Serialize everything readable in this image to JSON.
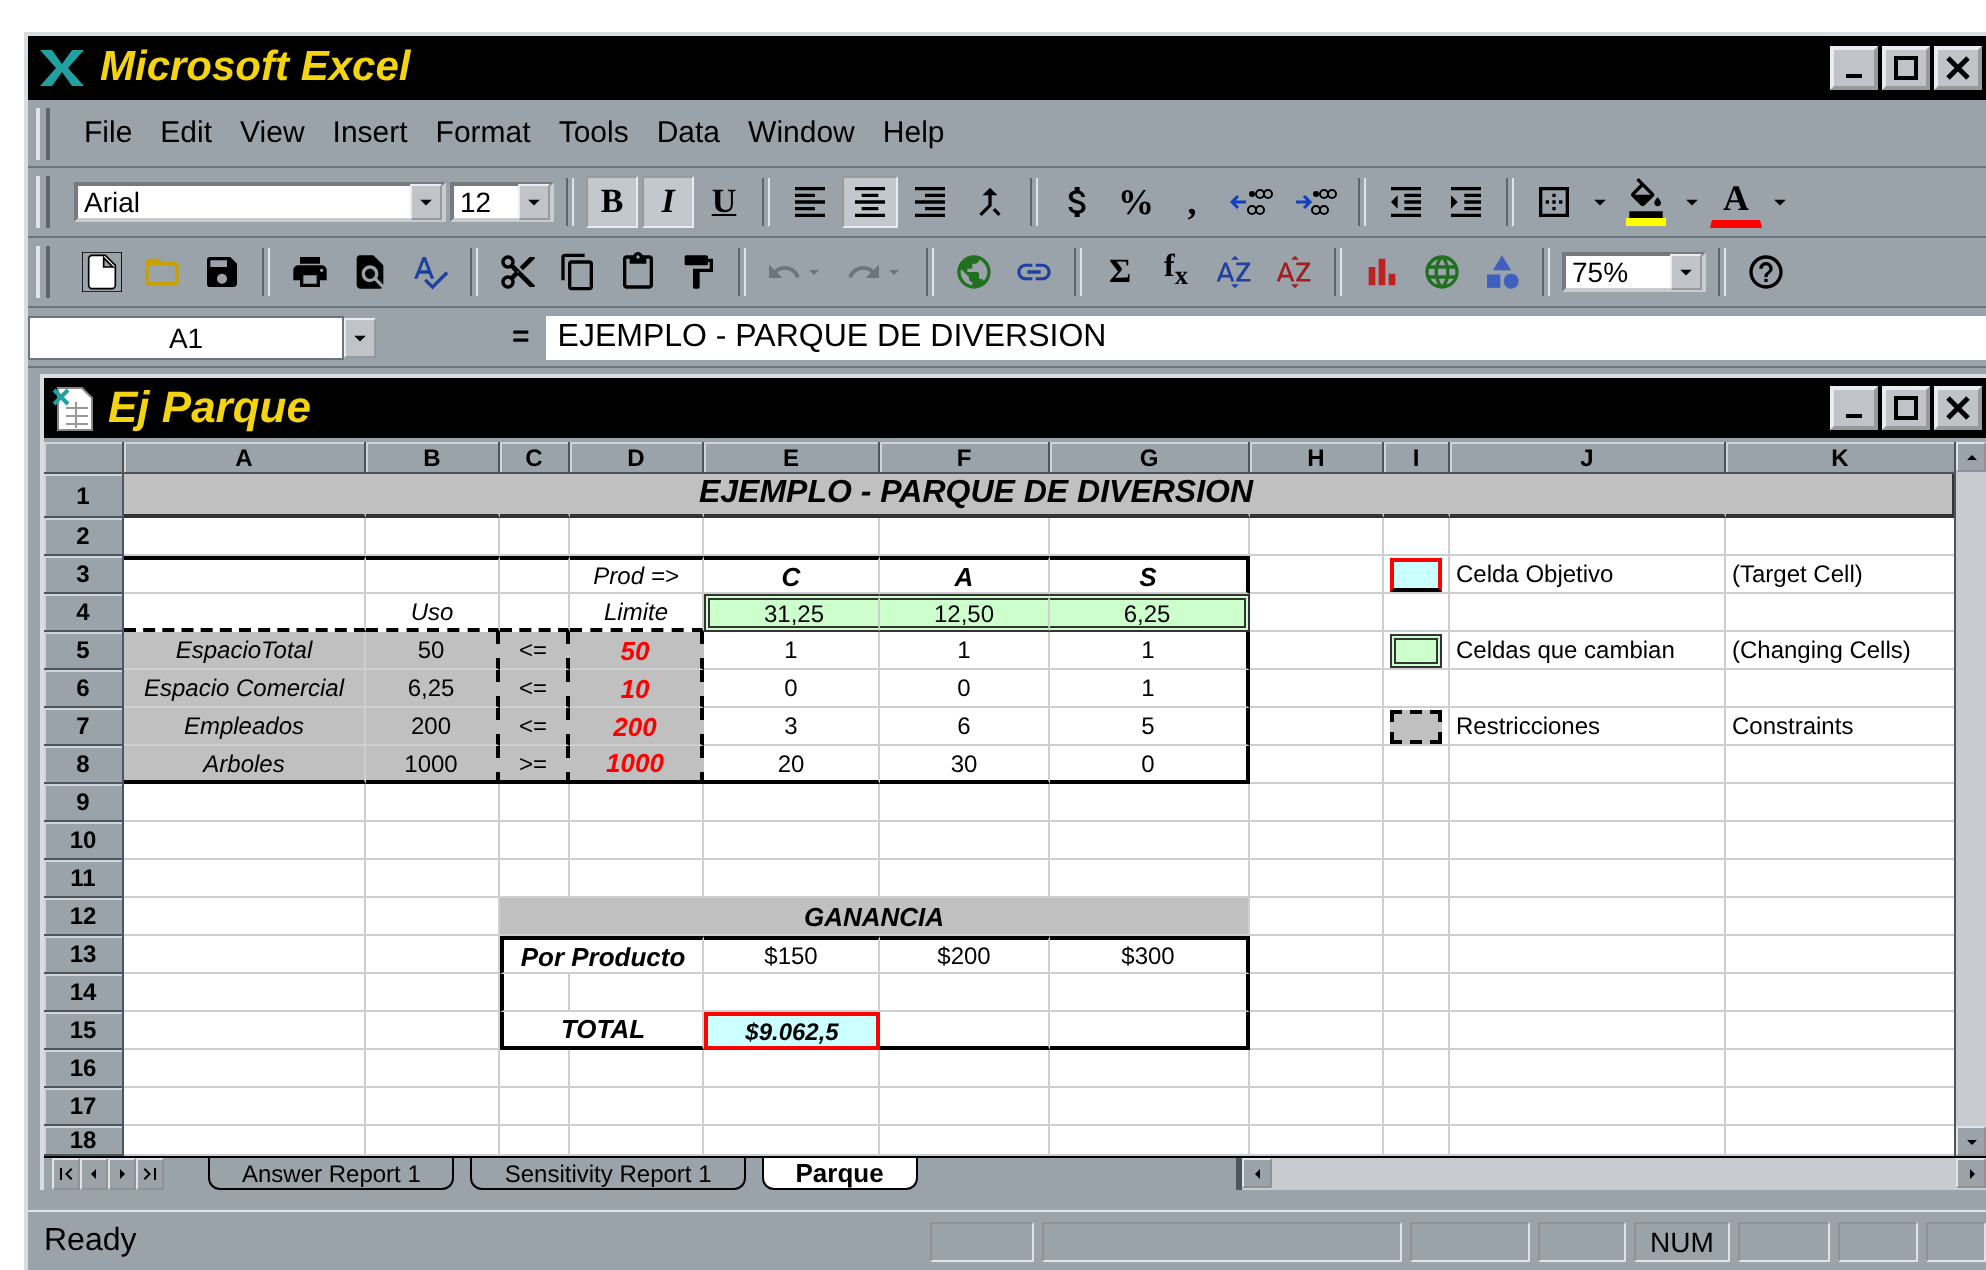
{
  "window": {
    "title": "Microsoft Excel"
  },
  "menu": [
    {
      "label": "File"
    },
    {
      "label": "Edit"
    },
    {
      "label": "View"
    },
    {
      "label": "Insert"
    },
    {
      "label": "Format"
    },
    {
      "label": "Tools"
    },
    {
      "label": "Data"
    },
    {
      "label": "Window"
    },
    {
      "label": "Help"
    }
  ],
  "formatting_toolbar": {
    "font": "Arial",
    "size": "12",
    "style_buttons": [
      {
        "label": "B",
        "kind": "bold",
        "selected": true
      },
      {
        "label": "I",
        "kind": "italic",
        "selected": true
      },
      {
        "label": "U",
        "kind": "underline",
        "selected": false
      }
    ],
    "alignment": [
      {
        "kind": "left",
        "selected": false
      },
      {
        "kind": "center",
        "selected": true
      },
      {
        "kind": "right",
        "selected": false
      }
    ],
    "number_buttons": [
      "%",
      ","
    ],
    "font_color_label": "A"
  },
  "standard_toolbar": {
    "history": [
      {
        "kind": "undo",
        "disabled": true
      },
      {
        "kind": "redo",
        "disabled": true
      }
    ],
    "sum_label": "Σ",
    "function_label": "f$_{x}$",
    "zoom": "75%"
  },
  "formula_bar": {
    "name_box": "A1",
    "equals": "=",
    "content": "EJEMPLO - PARQUE DE DIVERSION"
  },
  "workbook": {
    "title": "Ej Parque",
    "columns": [
      "A",
      "B",
      "C",
      "D",
      "E",
      "F",
      "G",
      "H",
      "I",
      "J",
      "K"
    ],
    "rows": [
      {
        "number": "1",
        "cells": [
          null,
          null,
          null,
          null,
          {
            "text": "EJEMPLO - PARQUE DE DIVERSION",
            "kind": "title"
          },
          null,
          null,
          null,
          null,
          null,
          null
        ]
      },
      {
        "number": "2",
        "cells": [
          null,
          null,
          null,
          null,
          null,
          null,
          null,
          null,
          null,
          null,
          null
        ]
      },
      {
        "number": "3",
        "cells": [
          null,
          null,
          null,
          {
            "text": "Prod =>",
            "kind": "label"
          },
          {
            "text": "C",
            "kind": "product"
          },
          {
            "text": "A",
            "kind": "product"
          },
          {
            "text": "S",
            "kind": "product"
          },
          null,
          {
            "kind": "target-swatch"
          },
          {
            "text": "Celda Objetivo",
            "kind": "legend"
          },
          {
            "text": "(Target Cell)",
            "kind": "legend"
          }
        ]
      },
      {
        "number": "4",
        "cells": [
          null,
          {
            "text": "Uso",
            "kind": "label"
          },
          null,
          {
            "text": "Limite",
            "kind": "label"
          },
          {
            "text": "31,25",
            "kind": "changing"
          },
          {
            "text": "12,50",
            "kind": "changing"
          },
          {
            "text": "6,25",
            "kind": "changing"
          },
          null,
          null,
          null,
          null
        ]
      },
      {
        "number": "5",
        "cells": [
          {
            "text": "EspacioTotal",
            "kind": "label"
          },
          {
            "text": "50",
            "kind": "value"
          },
          {
            "text": "<=",
            "kind": "value"
          },
          {
            "text": "50",
            "kind": "limit"
          },
          {
            "text": "1",
            "kind": "value"
          },
          {
            "text": "1",
            "kind": "value"
          },
          {
            "text": "1",
            "kind": "value"
          },
          null,
          {
            "kind": "changing-swatch"
          },
          {
            "text": "Celdas que cambian",
            "kind": "legend"
          },
          {
            "text": "(Changing Cells)",
            "kind": "legend"
          }
        ]
      },
      {
        "number": "6",
        "cells": [
          {
            "text": "Espacio Comercial",
            "kind": "label"
          },
          {
            "text": "6,25",
            "kind": "value"
          },
          {
            "text": "<=",
            "kind": "value"
          },
          {
            "text": "10",
            "kind": "limit"
          },
          {
            "text": "0",
            "kind": "value"
          },
          {
            "text": "0",
            "kind": "value"
          },
          {
            "text": "1",
            "kind": "value"
          },
          null,
          null,
          null,
          null
        ]
      },
      {
        "number": "7",
        "cells": [
          {
            "text": "Empleados",
            "kind": "label"
          },
          {
            "text": "200",
            "kind": "value"
          },
          {
            "text": "<=",
            "kind": "value"
          },
          {
            "text": "200",
            "kind": "limit"
          },
          {
            "text": "3",
            "kind": "value"
          },
          {
            "text": "6",
            "kind": "value"
          },
          {
            "text": "5",
            "kind": "value"
          },
          null,
          {
            "kind": "constraint-swatch"
          },
          {
            "text": "Restricciones",
            "kind": "legend"
          },
          {
            "text": "Constraints",
            "kind": "legend"
          }
        ]
      },
      {
        "number": "8",
        "cells": [
          {
            "text": "Arboles",
            "kind": "label"
          },
          {
            "text": "1000",
            "kind": "value"
          },
          {
            "text": ">=",
            "kind": "value"
          },
          {
            "text": "1000",
            "kind": "limit"
          },
          {
            "text": "20",
            "kind": "value"
          },
          {
            "text": "30",
            "kind": "value"
          },
          {
            "text": "0",
            "kind": "value"
          },
          null,
          null,
          null,
          null
        ]
      },
      {
        "number": "9",
        "cells": [
          null,
          null,
          null,
          null,
          null,
          null,
          null,
          null,
          null,
          null,
          null
        ]
      },
      {
        "number": "10",
        "cells": [
          null,
          null,
          null,
          null,
          null,
          null,
          null,
          null,
          null,
          null,
          null
        ]
      },
      {
        "number": "11",
        "cells": [
          null,
          null,
          null,
          null,
          null,
          null,
          null,
          null,
          null,
          null,
          null
        ]
      },
      {
        "number": "12",
        "cells": [
          null,
          null,
          {
            "text": "GANANCIA",
            "kind": "section"
          },
          null,
          null,
          null,
          null,
          null,
          null,
          null,
          null
        ]
      },
      {
        "number": "13",
        "cells": [
          null,
          null,
          {
            "text": "Por Producto",
            "kind": "rowlabel"
          },
          null,
          {
            "text": "$150",
            "kind": "value"
          },
          {
            "text": "$200",
            "kind": "value"
          },
          {
            "text": "$300",
            "kind": "value"
          },
          null,
          null,
          null,
          null
        ]
      },
      {
        "number": "14",
        "cells": [
          null,
          null,
          null,
          null,
          null,
          null,
          null,
          null,
          null,
          null,
          null
        ]
      },
      {
        "number": "15",
        "cells": [
          null,
          null,
          {
            "text": "TOTAL",
            "kind": "rowlabel"
          },
          null,
          {
            "text": "$9.062,5",
            "kind": "target"
          },
          null,
          null,
          null,
          null,
          null,
          null
        ]
      },
      {
        "number": "16",
        "cells": [
          null,
          null,
          null,
          null,
          null,
          null,
          null,
          null,
          null,
          null,
          null
        ]
      },
      {
        "number": "17",
        "cells": [
          null,
          null,
          null,
          null,
          null,
          null,
          null,
          null,
          null,
          null,
          null
        ]
      },
      {
        "number": "18",
        "cells": [
          null,
          null,
          null,
          null,
          null,
          null,
          null,
          null,
          null,
          null,
          null
        ]
      }
    ],
    "sheet_tabs": [
      {
        "label": "Answer Report 1",
        "selected": false
      },
      {
        "label": "Sensitivity Report 1",
        "selected": false
      },
      {
        "label": "Parque",
        "selected": true
      }
    ]
  },
  "status_bar": {
    "text": "Ready",
    "indicator": "NUM"
  }
}
